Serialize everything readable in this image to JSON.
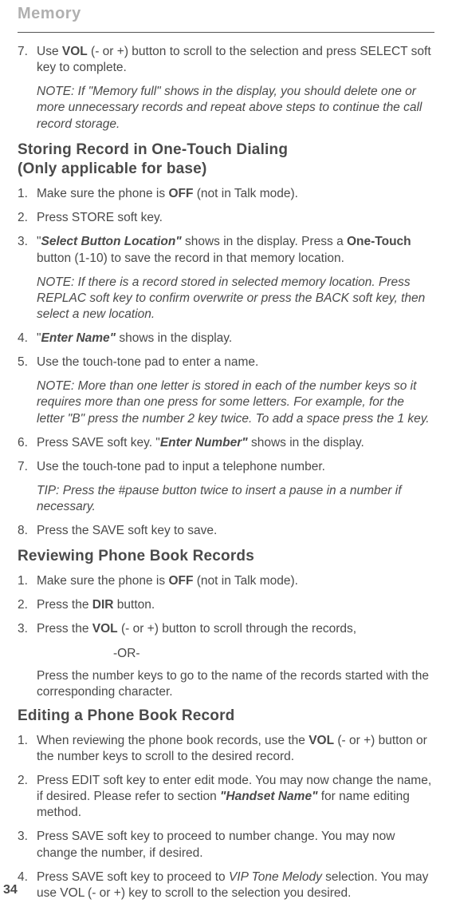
{
  "header": {
    "section_title": "Memory"
  },
  "s1": {
    "item7_num": "7.",
    "item7_t1": "Use ",
    "item7_vol": "VOL",
    "item7_t2": " (- or +) button to scroll to the selection and press SELECT soft key to complete.",
    "note1": "NOTE: If \"Memory full\" shows in the display, you should delete one or more unnecessary records and repeat above steps to continue the call record storage."
  },
  "h_storing_l1": "Storing Record in One-Touch Dialing",
  "h_storing_l2": "(Only applicable for base)",
  "s2": {
    "i1_num": "1.",
    "i1_t1": "Make sure the phone is ",
    "i1_off": "OFF",
    "i1_t2": " (not in Talk mode).",
    "i2_num": "2.",
    "i2_t": "Press STORE soft key.",
    "i3_num": "3.",
    "i3_q1": "\"",
    "i3_sel": "Select Button Location\"",
    "i3_t1": " shows in the display. Press a ",
    "i3_ot": "One-Touch",
    "i3_t2": " button (1-10) to save the record in that memory location.",
    "note2": "NOTE: If there is a record stored in selected memory location. Press REPLAC soft key to confirm overwrite or press the BACK soft key, then select a new location.",
    "i4_num": "4.",
    "i4_q1": "\"",
    "i4_en": "Enter Name\"",
    "i4_t1": " shows in the display.",
    "i5_num": "5.",
    "i5_t": "Use the touch-tone pad to enter a name.",
    "note3": "NOTE: More than one letter is stored in each of the number keys so it requires more than one press for some letters. For example, for the letter \"B\" press the number 2 key twice. To add a space press the 1 key.",
    "i6_num": "6.",
    "i6_t1": "Press SAVE soft key. \"",
    "i6_en": "Enter Number\"",
    "i6_t2": " shows in the display.",
    "i7_num": "7.",
    "i7_t": "Use the touch-tone pad to input a telephone number.",
    "tip": "TIP: Press the #pause button twice to insert a pause in a number if necessary.",
    "i8_num": "8.",
    "i8_t": "Press the SAVE soft key to save."
  },
  "h_review": "Reviewing Phone Book Records",
  "s3": {
    "i1_num": "1.",
    "i1_t1": "Make sure the phone is ",
    "i1_off": "OFF",
    "i1_t2": " (not in Talk mode).",
    "i2_num": "2.",
    "i2_t1": "Press the ",
    "i2_dir": "DIR",
    "i2_t2": " button.",
    "i3_num": "3.",
    "i3_t1": "Press the ",
    "i3_vol": "VOL",
    "i3_t2": " (- or +) button to scroll through the records,",
    "or": "-OR-",
    "i3_follow": "Press the number keys to go to the name of the records started with the corresponding character."
  },
  "h_edit": "Editing a Phone Book Record",
  "s4": {
    "i1_num": "1.",
    "i1_t1": "When reviewing the phone book records, use the ",
    "i1_vol": "VOL",
    "i1_t2": " (- or +) button or the number keys to scroll to the desired record.",
    "i2_num": "2.",
    "i2_t1": "Press EDIT soft key to enter edit mode. You may now change the name, if desired. Please refer to section ",
    "i2_hn": "\"Handset Name\"",
    "i2_t2": " for name editing method.",
    "i3_num": "3.",
    "i3_t": "Press SAVE soft key to proceed to number change. You may now change the number, if desired.",
    "i4_num": "4.",
    "i4_t1": "Press SAVE soft key to proceed to ",
    "i4_vip": "VIP Tone Melody",
    "i4_t2": " selection. You may use VOL (- or +) key to scroll to the selection you desired."
  },
  "page_number": "34"
}
